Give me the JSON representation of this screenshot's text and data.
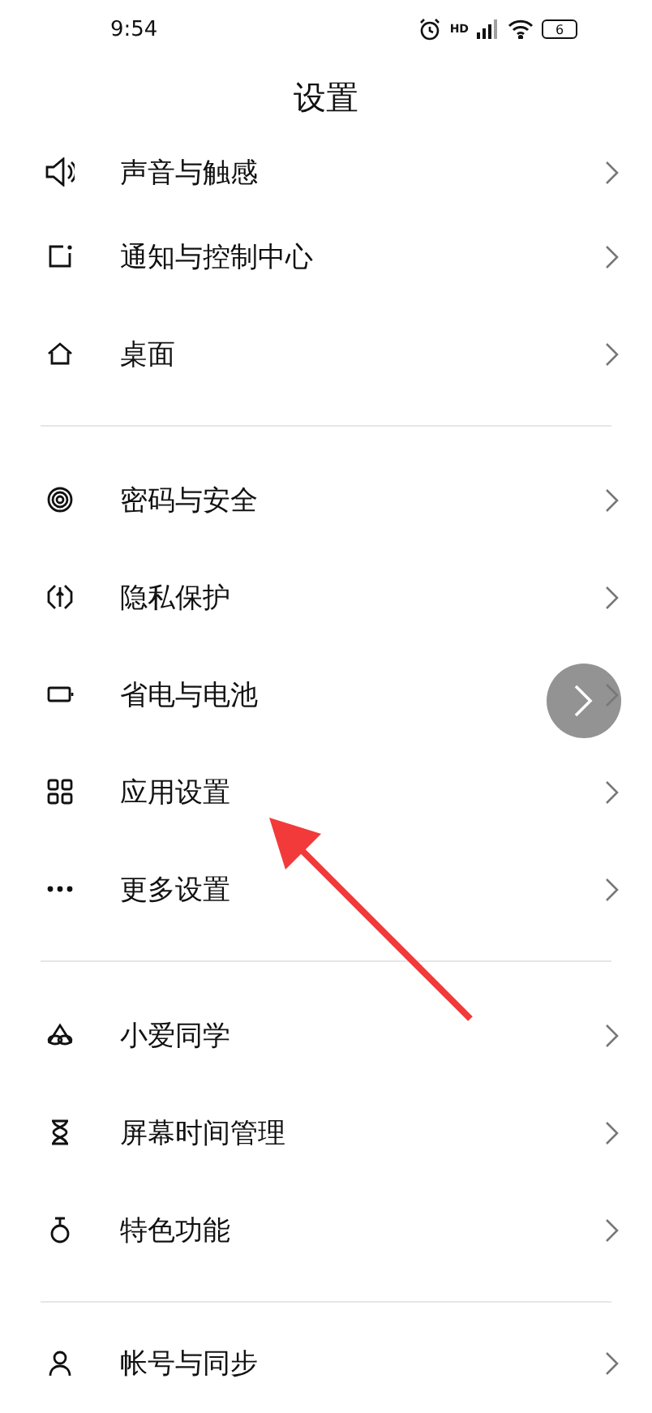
{
  "status_bar": {
    "time": "9:54",
    "network": "HD",
    "battery": "6"
  },
  "title": "设置",
  "sections": [
    {
      "items": [
        {
          "label": "声音与触感"
        },
        {
          "label": "通知与控制中心"
        },
        {
          "label": "桌面"
        }
      ]
    },
    {
      "items": [
        {
          "label": "密码与安全"
        },
        {
          "label": "隐私保护"
        },
        {
          "label": "省电与电池"
        },
        {
          "label": "应用设置"
        },
        {
          "label": "更多设置"
        }
      ]
    },
    {
      "items": [
        {
          "label": "小爱同学"
        },
        {
          "label": "屏幕时间管理"
        },
        {
          "label": "特色功能"
        }
      ]
    },
    {
      "items": [
        {
          "label": "帐号与同步"
        }
      ]
    }
  ]
}
